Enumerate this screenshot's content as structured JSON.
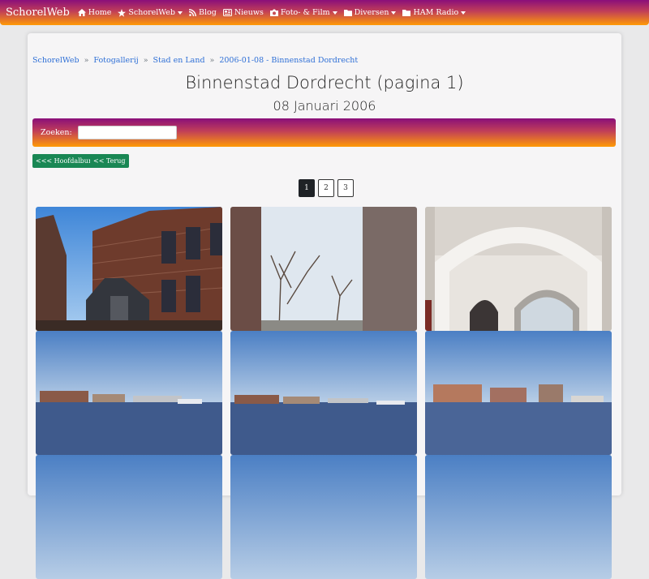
{
  "navbar": {
    "brand": "SchorelWeb",
    "items": [
      {
        "label": "Home",
        "icon": "home-icon",
        "dropdown": false
      },
      {
        "label": "SchorelWeb",
        "icon": "star-icon",
        "dropdown": true
      },
      {
        "label": "Blog",
        "icon": "rss-icon",
        "dropdown": false
      },
      {
        "label": "Nieuws",
        "icon": "newspaper-icon",
        "dropdown": false
      },
      {
        "label": "Foto- & Film",
        "icon": "camera-icon",
        "dropdown": true
      },
      {
        "label": "Diversen",
        "icon": "folder-icon",
        "dropdown": true
      },
      {
        "label": "HAM Radio",
        "icon": "folder-icon",
        "dropdown": true
      }
    ],
    "gradient_start": "#8a0f7a",
    "gradient_end": "#ff9a06"
  },
  "breadcrumb": {
    "items": [
      "SchorelWeb",
      "Fotogallerij",
      "Stad en Land",
      "2006-01-08 - Binnenstad Dordrecht"
    ],
    "separator": "»"
  },
  "page": {
    "title": "Binnenstad Dordrecht (pagina 1)",
    "subtitle": "08 Januari 2006"
  },
  "search": {
    "label": "Zoeken:",
    "value": "",
    "placeholder": ""
  },
  "buttons": {
    "main_album": "<<< Hoofdalbum",
    "back": "<< Terug"
  },
  "pagination": {
    "pages": [
      "1",
      "2",
      "3"
    ],
    "active": "1"
  },
  "gallery": {
    "photos": [
      {
        "scene": "building-facade"
      },
      {
        "scene": "tower-trees"
      },
      {
        "scene": "archway"
      },
      {
        "scene": "river-skyline"
      },
      {
        "scene": "river-skyline"
      },
      {
        "scene": "river-skyline"
      },
      {
        "scene": "sky"
      },
      {
        "scene": "sky"
      },
      {
        "scene": "sky"
      }
    ]
  },
  "colors": {
    "link": "#2e6fd6",
    "button_green": "#198754",
    "active_page": "#1f2226"
  }
}
